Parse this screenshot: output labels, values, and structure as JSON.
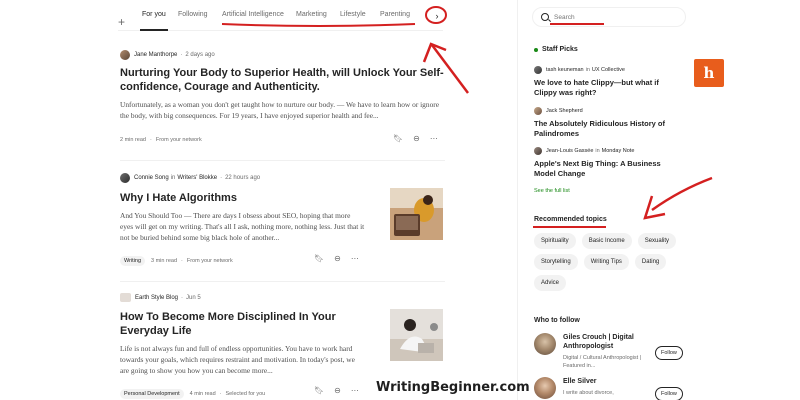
{
  "tabs": {
    "add_icon": "plus-icon",
    "items": [
      "For you",
      "Following",
      "Artificial Intelligence",
      "Marketing",
      "Lifestyle",
      "Parenting"
    ],
    "more_icon": "chevron-right-icon"
  },
  "articles": [
    {
      "author": "Jane Manthorpe",
      "publication": "",
      "in_word": "",
      "time": "2 days ago",
      "title": "Nurturing Your Body to Superior Health, will Unlock Your Self-confidence, Courage and Authenticity.",
      "excerpt": "Unfortunately, as a woman you don't get taught how to nurture our body. — We have to learn how or ignore the body, with big consequences. For 19 years, I have enjoyed superior health and fee...",
      "tag": "",
      "read_time": "2 min read",
      "source": "From your network"
    },
    {
      "author": "Connie Song",
      "in_word": "in",
      "publication": "Writers' Blokke",
      "time": "22 hours ago",
      "title": "Why I Hate Algorithms",
      "excerpt": "And You Should Too — There are days I obsess about SEO, hoping that more eyes will get on my writing. That's all I ask, nothing more, nothing less. Just that it not be buried behind some big black hole of another...",
      "tag": "Writing",
      "read_time": "3 min read",
      "source": "From your network"
    },
    {
      "author": "Earth Style Blog",
      "in_word": "",
      "publication": "",
      "time": "Jun 5",
      "title": "How To Become More Disciplined In Your Everyday Life",
      "excerpt": "Life is not always fun and full of endless opportunities. You have to work hard towards your goals, which requires restraint and motivation. In today's post, we are going to show you how you can become more...",
      "tag": "Personal Development",
      "read_time": "4 min read",
      "source": "Selected for you"
    }
  ],
  "sidebar": {
    "search_placeholder": "Search",
    "staff_picks_title": "Staff Picks",
    "picks": [
      {
        "author": "tash keuneman",
        "in_word": "in",
        "publication": "UX Collective",
        "title": "We love to hate Clippy—but what if Clippy was right?"
      },
      {
        "author": "Jack Shepherd",
        "in_word": "",
        "publication": "",
        "title": "The Absolutely Ridiculous History of Palindromes"
      },
      {
        "author": "Jean-Louis Gassée",
        "in_word": "in",
        "publication": "Monday Note",
        "title": "Apple's Next Big Thing: A Business Model Change"
      }
    ],
    "full_list": "See the full list",
    "recommended_title": "Recommended topics",
    "topics": [
      "Spirituality",
      "Basic Income",
      "Sexuality",
      "Storytelling",
      "Writing Tips",
      "Dating",
      "Advice"
    ],
    "who_to_follow_title": "Who to follow",
    "follow": [
      {
        "name": "Giles Crouch | Digital Anthropologist",
        "bio": "Digital / Cultural Anthropologist | Featured in...",
        "button": "Follow"
      },
      {
        "name": "Elle Silver",
        "bio": "I write about divorce,",
        "button": "Follow"
      }
    ],
    "badge_letter": "h"
  },
  "watermark": "WritingBeginner.com",
  "colors": {
    "accent_green": "#1a8917",
    "annotation_red": "#d42020",
    "badge_orange": "#e85d1c"
  }
}
